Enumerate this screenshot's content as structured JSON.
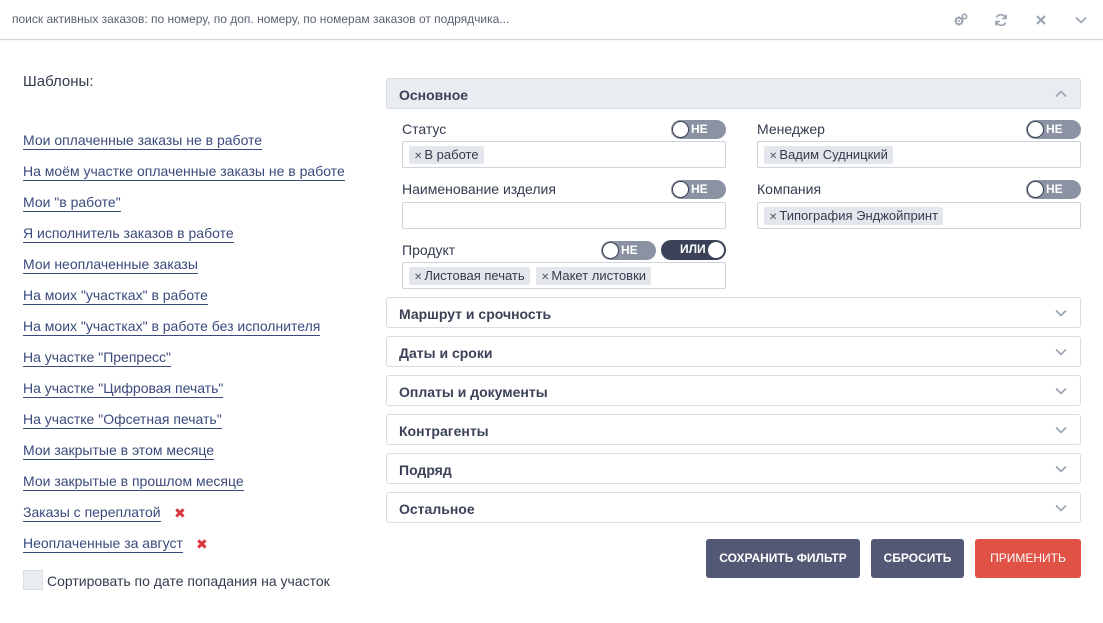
{
  "search": {
    "placeholder": "поиск активных заказов: по номеру, по доп. номеру, по номерам заказов от подрядчика..."
  },
  "templates": {
    "title": "Шаблоны:",
    "items": [
      {
        "label": "Мои оплаченные заказы не в работе"
      },
      {
        "label": "На моём участке оплаченные заказы не в работе"
      },
      {
        "label": "Мои \"в работе\""
      },
      {
        "label": "Я исполнитель заказов в работе"
      },
      {
        "label": "Мои неоплаченные заказы"
      },
      {
        "label": "На моих \"участках\" в работе"
      },
      {
        "label": "На моих \"участках\" в работе без исполнителя"
      },
      {
        "label": "На участке \"Препресс\""
      },
      {
        "label": "На участке \"Цифровая печать\""
      },
      {
        "label": "На участке \"Офсетная печать\""
      },
      {
        "label": "Мои закрытые в этом месяце"
      },
      {
        "label": "Мои закрытые в прошлом месяце"
      },
      {
        "label": "Заказы с переплатой",
        "deletable": true
      },
      {
        "label": "Неоплаченные за август",
        "deletable": true
      }
    ],
    "sort_label": "Сортировать по дате попадания на участок"
  },
  "sections": {
    "main": "Основное",
    "route": "Маршрут и срочность",
    "dates": "Даты и сроки",
    "payments": "Оплаты и документы",
    "contractors": "Контрагенты",
    "subcontract": "Подряд",
    "other": "Остальное"
  },
  "fields": {
    "status": {
      "label": "Статус",
      "toggle": "НЕ",
      "tags": [
        "В работе"
      ]
    },
    "manager": {
      "label": "Менеджер",
      "toggle": "НЕ",
      "tags": [
        "Вадим Судницкий"
      ]
    },
    "product_name": {
      "label": "Наименование изделия",
      "toggle": "НЕ",
      "value": ""
    },
    "company": {
      "label": "Компания",
      "toggle": "НЕ",
      "tags": [
        "Типография Энджойпринт"
      ]
    },
    "product": {
      "label": "Продукт",
      "toggle": "НЕ",
      "toggle2": "ИЛИ",
      "tags": [
        "Листовая печать",
        "Макет листовки"
      ]
    }
  },
  "buttons": {
    "save": "СОХРАНИТЬ ФИЛЬТР",
    "reset": "СБРОСИТЬ",
    "apply": "ПРИМЕНИТЬ"
  },
  "colors": {
    "accent_dark": "#535874",
    "apply_red": "#e05246",
    "link": "#3a4a7c",
    "delete": "#d9363e"
  },
  "icons": {
    "settings": "gears-icon",
    "refresh": "refresh-icon",
    "clear": "close-icon",
    "expand": "chevron-down-icon"
  }
}
